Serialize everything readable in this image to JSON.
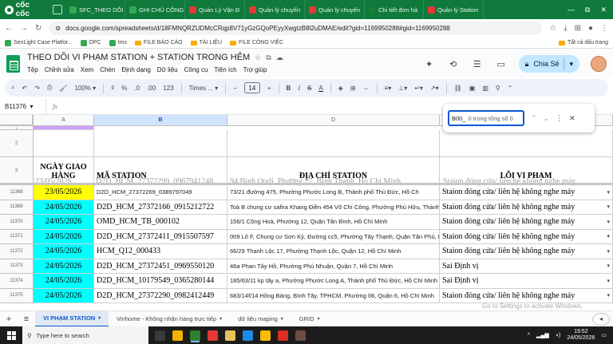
{
  "browser": {
    "brand": "cốc cốc",
    "tabs": [
      {
        "label": "SFC_THEO DÕI",
        "favicon": "green",
        "active": false
      },
      {
        "label": "GHI CHÚ CÔNG",
        "favicon": "green",
        "active": false
      },
      {
        "label": "Quản Lý Vận Đ",
        "favicon": "red",
        "active": false
      },
      {
        "label": "Quản lý chuyến",
        "favicon": "red",
        "active": false
      },
      {
        "label": "Quản lý chuyến",
        "favicon": "red",
        "active": false
      },
      {
        "label": "Chi tiết đơn hà",
        "favicon": "gr2",
        "active": false
      },
      {
        "label": "Quản lý Station",
        "favicon": "red",
        "active": false
      }
    ],
    "window_controls": [
      "—",
      "⧉",
      "✕"
    ],
    "url": "docs.google.com/spreadsheets/d/18FMNQRZUDMcCRqp8V71yGzGQoPEyyXwgtzB8l2uDMAE/edit?gid=1169950288#gid=1169950288",
    "bookmarks": [
      {
        "label": "SenLight Case Platfor...",
        "type": "app"
      },
      {
        "label": "OPC",
        "type": "app"
      },
      {
        "label": "tms",
        "type": "app"
      },
      {
        "label": "FILE BÁO CÁO",
        "type": "folder"
      },
      {
        "label": "TÀI LIỆU",
        "type": "folder"
      },
      {
        "label": "FILE CÔNG VIỆC",
        "type": "folder"
      }
    ],
    "bookmarks_right": "Tất cả dấu trang"
  },
  "sheets": {
    "title": "THEO DÕI VI PHẠM STATION + STATION TRONG HẺM",
    "menu": [
      "Tệp",
      "Chỉnh sửa",
      "Xem",
      "Chèn",
      "Định dạng",
      "Dữ liệu",
      "Công cụ",
      "Tiện ích",
      "Trợ giúp"
    ],
    "share_label": "Chia Sẻ",
    "toolbar": {
      "zoom": "100%",
      "currency": "₫",
      "percent": "%",
      "dec_less": ".0",
      "dec_more": ".00",
      "number_format": "123",
      "font": "Times ...",
      "font_size": "14",
      "bold": "B",
      "italic": "I",
      "strike": "S",
      "text_color": "A"
    },
    "name_box": "B11376",
    "fx": "fx"
  },
  "grid": {
    "columns": [
      {
        "letter": "A",
        "selected": false
      },
      {
        "letter": "B",
        "selected": true
      },
      {
        "letter": "D",
        "selected": false
      },
      {
        "letter": "E",
        "selected": false
      }
    ],
    "top_row_num": "1",
    "header_rows": [
      {
        "num": "2",
        "cells": [
          "",
          "",
          "",
          ""
        ]
      },
      {
        "num": "3",
        "cells": [
          "NGÀY GIAO HÀNG",
          "MÃ STATION",
          "ĐỊA CHỈ STATION",
          "LỖI VI PHẠM"
        ]
      }
    ],
    "behind_text": {
      "a": "23/05/2026",
      "b": "D2D_HCM_27372299_0967941248",
      "d": "94 Bình Quới, Phường 27, Bình Thạnh, Hồ Chí Minh",
      "e": "Staion đóng cửa/ liên hệ không nghe máy"
    },
    "rows": [
      {
        "num": "11368",
        "date": "23/05/2026",
        "date_color": "#ffff00",
        "station": "D2D_HCM_27372269_0389797049",
        "address": "73/21 đường 475, Phường Phước Long B, Thành phố Thủ Đức, Hồ Ch",
        "violation": "Staion đóng cửa/ liên hệ không nghe máy",
        "station_small": true
      },
      {
        "num": "11369",
        "date": "24/05/2026",
        "date_color": "#00ffff",
        "station": "D2D_HCM_27372166_0915212722",
        "address": "Toà B chung cư safira Khang Điền 454 Võ Chí Công, Phường Phú Hữu, Thành phố Thủ Đức, Hồ Chí Minh",
        "violation": "Staion đóng cửa/ liên hệ không nghe máy",
        "station_small": false
      },
      {
        "num": "11370",
        "date": "24/05/2026",
        "date_color": "#00ffff",
        "station": "OMD_HCM_TB_000102",
        "address": "156/1 Cộng Hoà, Phường 12, Quận Tân Bình, Hồ Chí Minh",
        "violation": "Staion đóng cửa/ liên hệ không nghe máy",
        "station_small": false
      },
      {
        "num": "11371",
        "date": "24/05/2026",
        "date_color": "#00ffff",
        "station": "D2D_HCM_27372411_0915507597",
        "address": "009 Lô F, Chung cư Sơn Kỳ, Đường cc5, Phường Tây Thạnh, Quận Tân Phú, Hồ Chí Minh",
        "violation": "Staion đóng cửa/ liên hệ không nghe máy",
        "station_small": false
      },
      {
        "num": "11372",
        "date": "24/05/2026",
        "date_color": "#00ffff",
        "station": "HCM_Q12_000433",
        "address": "66/29 Thạnh Lộc 17, Phường Thạnh Lộc, Quận 12, Hồ Chí Minh",
        "violation": "Staion đóng cửa/ liên hệ không nghe máy",
        "station_small": false
      },
      {
        "num": "11373",
        "date": "24/05/2026",
        "date_color": "#00ffff",
        "station": "D2D_HCM_27372451_0969550120",
        "address": "46a Phan Tây Hồ, Phường Phú Nhuận, Quận 7, Hồ Chí Minh",
        "violation": "Sai Định vị",
        "station_small": false
      },
      {
        "num": "11374",
        "date": "24/05/2026",
        "date_color": "#00ffff",
        "station": "D2D_HCM_10179549_0365280144",
        "address": "185/63/11 kp tây a, Phường Phước Long A, Thành phố Thủ Đức, Hồ Chí Minh",
        "violation": "Sai Định vị",
        "station_small": false
      },
      {
        "num": "11375",
        "date": "24/05/2026",
        "date_color": "#00ffff",
        "station": "D2D_HCM_27372290_0982412449",
        "address": "683/14f/14 Hồng Bàng, Bình Tây, TPHCM, Phường 06, Quận 6, Hồ Chí Minh",
        "violation": "Staion đóng cửa/ liên hệ không nghe máy",
        "station_small": false
      }
    ]
  },
  "find": {
    "query": "B00_",
    "count_text": "0 trong tổng số 0"
  },
  "watermark": "Go to Settings to activate Windows.",
  "sheet_tabs": {
    "add": "+",
    "all_sheets": "≡",
    "tabs": [
      {
        "label": "VI PHẠM STATION",
        "active": true
      },
      {
        "label": "Vinhome - Không nhận hàng trực tiếp",
        "active": false
      },
      {
        "label": "dữ liệu maping",
        "active": false
      },
      {
        "label": "GRID",
        "active": false
      }
    ],
    "right_btn": "◂"
  },
  "taskbar": {
    "search_placeholder": "Type here to search",
    "apps": [
      {
        "name": "task-view",
        "color": "#3a3a3a"
      },
      {
        "name": "file-explorer",
        "color": "#f2b300"
      },
      {
        "name": "coccoc",
        "color": "#2e7d32"
      },
      {
        "name": "app-w",
        "color": "#e53935"
      },
      {
        "name": "app-folder",
        "color": "#e8c15b"
      },
      {
        "name": "zalo",
        "color": "#1e88e5"
      },
      {
        "name": "chrome",
        "color": "#fbbc04"
      },
      {
        "name": "app-red",
        "color": "#d93025"
      },
      {
        "name": "app-dark",
        "color": "#6d4c41"
      }
    ],
    "time": "19:52",
    "date": "24/05/2026",
    "tray_chevron": "^"
  }
}
